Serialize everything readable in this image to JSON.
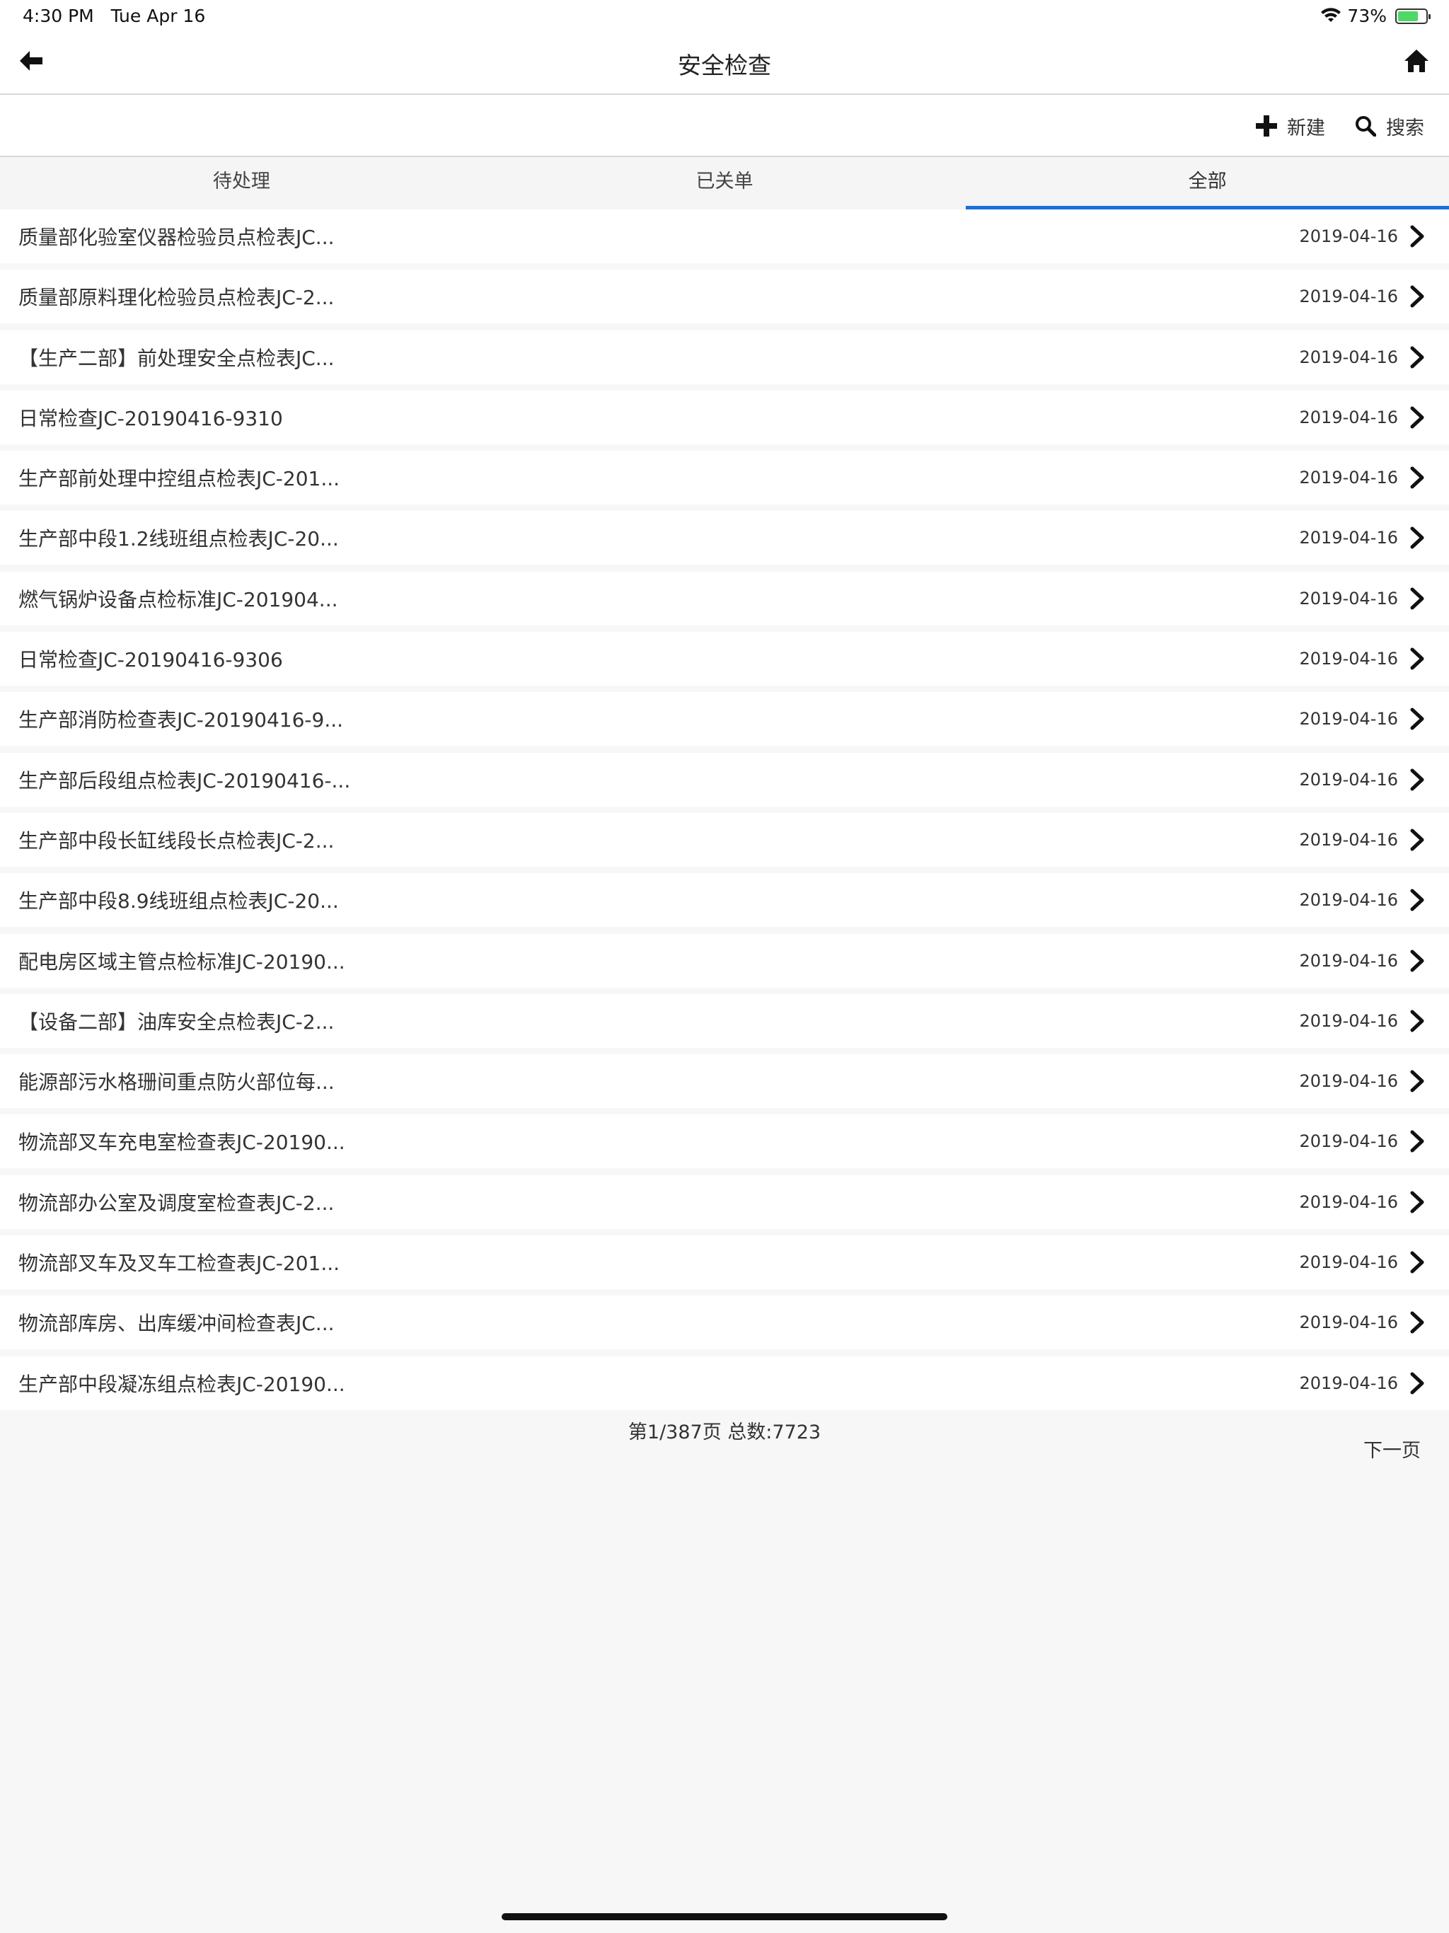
{
  "status_bar": {
    "time": "4:30 PM",
    "date": "Tue Apr 16",
    "battery_percent": "73%",
    "battery_level": 0.73,
    "icons": [
      "wifi-icon",
      "battery-icon"
    ]
  },
  "nav": {
    "title": "安全检查",
    "back_icon": "arrow-left-icon",
    "home_icon": "home-icon"
  },
  "toolbar": {
    "new_label": "新建",
    "search_label": "搜索",
    "new_icon": "plus-icon",
    "search_icon": "search-icon"
  },
  "tabs": [
    {
      "label": "待处理",
      "active": false
    },
    {
      "label": "已关单",
      "active": false
    },
    {
      "label": "全部",
      "active": true
    }
  ],
  "items": [
    {
      "title": "质量部化验室仪器检验员点检表JC...",
      "date": "2019-04-16"
    },
    {
      "title": "质量部原料理化检验员点检表JC-2...",
      "date": "2019-04-16"
    },
    {
      "title": "【生产二部】前处理安全点检表JC...",
      "date": "2019-04-16"
    },
    {
      "title": "日常检查JC-20190416-9310",
      "date": "2019-04-16"
    },
    {
      "title": "生产部前处理中控组点检表JC-201...",
      "date": "2019-04-16"
    },
    {
      "title": "生产部中段1.2线班组点检表JC-20...",
      "date": "2019-04-16"
    },
    {
      "title": "燃气锅炉设备点检标准JC-201904...",
      "date": "2019-04-16"
    },
    {
      "title": "日常检查JC-20190416-9306",
      "date": "2019-04-16"
    },
    {
      "title": "生产部消防检查表JC-20190416-9...",
      "date": "2019-04-16"
    },
    {
      "title": "生产部后段组点检表JC-20190416-...",
      "date": "2019-04-16"
    },
    {
      "title": "生产部中段长缸线段长点检表JC-2...",
      "date": "2019-04-16"
    },
    {
      "title": "生产部中段8.9线班组点检表JC-20...",
      "date": "2019-04-16"
    },
    {
      "title": "配电房区域主管点检标准JC-20190...",
      "date": "2019-04-16"
    },
    {
      "title": "【设备二部】油库安全点检表JC-2...",
      "date": "2019-04-16"
    },
    {
      "title": "能源部污水格珊间重点防火部位每...",
      "date": "2019-04-16"
    },
    {
      "title": "物流部叉车充电室检查表JC-20190...",
      "date": "2019-04-16"
    },
    {
      "title": "物流部办公室及调度室检查表JC-2...",
      "date": "2019-04-16"
    },
    {
      "title": "物流部叉车及叉车工检查表JC-201...",
      "date": "2019-04-16"
    },
    {
      "title": "物流部库房、出库缓冲间检查表JC...",
      "date": "2019-04-16"
    },
    {
      "title": "生产部中段凝冻组点检表JC-20190...",
      "date": "2019-04-16"
    }
  ],
  "pager": {
    "info": "第1/387页 总数:7723",
    "next_label": "下一页"
  },
  "colors": {
    "accent": "#1c6fd8",
    "background": "#f7f7f7",
    "battery": "#4cd964"
  }
}
